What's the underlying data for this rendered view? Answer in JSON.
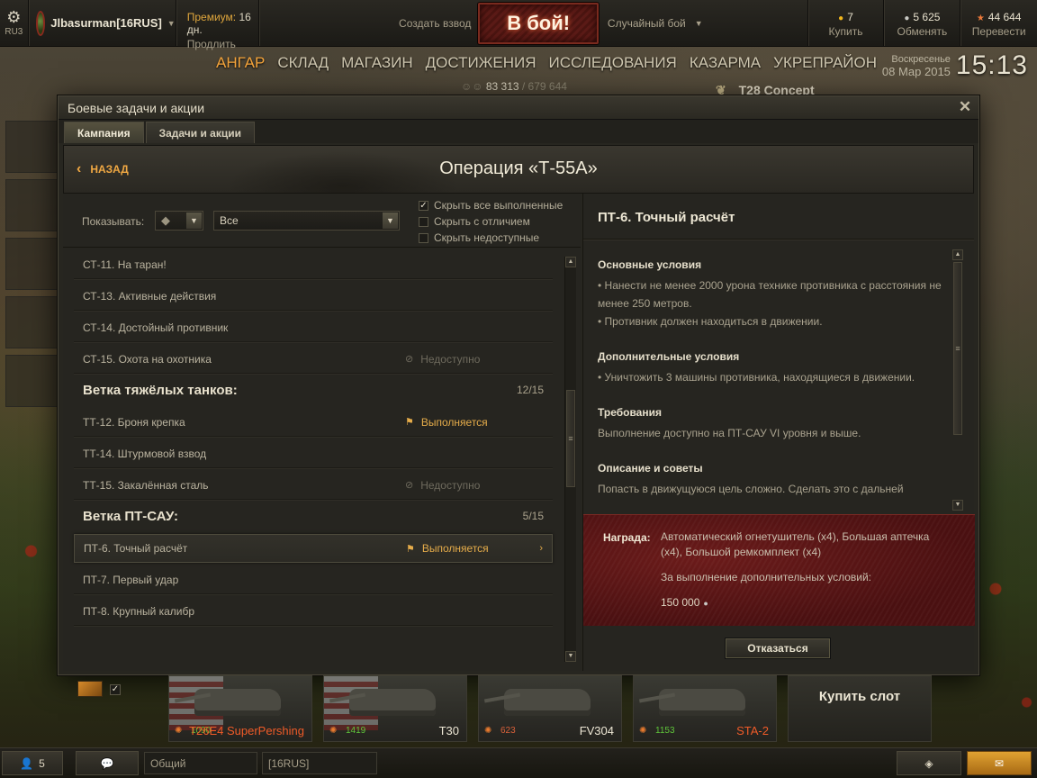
{
  "topbar": {
    "server_icon": "gear-icon",
    "server": "RU3",
    "username": "Jlbasurman[16RUS]",
    "premium_label": "Премиум:",
    "premium_value": "16 дн.",
    "premium_action": "Продлить",
    "platoon": "Создать взвод",
    "battle_button": "В бой!",
    "battle_mode": "Случайный бой",
    "gold_value": "7",
    "gold_action": "Купить",
    "credits_value": "5 625",
    "credits_action": "Обменять",
    "xp_value": "44 644",
    "xp_action": "Перевести"
  },
  "nav": {
    "items": [
      "АНГАР",
      "СКЛАД",
      "МАГАЗИН",
      "ДОСТИЖЕНИЯ",
      "ИССЛЕДОВАНИЯ",
      "КАЗАРМА",
      "УКРЕПРАЙОН"
    ],
    "active_index": 0
  },
  "clock": {
    "weekday": "Воскресенье",
    "date": "08 Мар 2015",
    "time": "15:13"
  },
  "hangar": {
    "online": "83 313",
    "online_total": "/ 679 644",
    "tank_name": "T28 Concept"
  },
  "modal": {
    "title": "Боевые задачи и акции",
    "close": "✕",
    "tabs": [
      "Кампания",
      "Задачи и акции"
    ],
    "active_tab": 0,
    "back_label": "НАЗАД",
    "operation_title": "Операция «Т-55А»"
  },
  "filter": {
    "show_label": "Показывать:",
    "type_value": "◆",
    "category_value": "Все",
    "checkboxes": [
      {
        "label": "Скрыть все выполненные",
        "checked": true
      },
      {
        "label": "Скрыть с отличием",
        "checked": false
      },
      {
        "label": "Скрыть недоступные",
        "checked": false
      }
    ]
  },
  "quests": {
    "rows": [
      {
        "name": "СТ-11. На таран!",
        "status": ""
      },
      {
        "name": "СТ-13. Активные действия",
        "status": ""
      },
      {
        "name": "СТ-14. Достойный противник",
        "status": ""
      },
      {
        "name": "СТ-15. Охота на охотника",
        "status": "Недоступно"
      }
    ],
    "branch_heavy": {
      "title": "Ветка тяжёлых танков:",
      "count": "12/15"
    },
    "heavy_rows": [
      {
        "name": "ТТ-12. Броня крепка",
        "status": "Выполняется"
      },
      {
        "name": "ТТ-14. Штурмовой взвод",
        "status": ""
      },
      {
        "name": "ТТ-15. Закалённая сталь",
        "status": "Недоступно"
      }
    ],
    "branch_td": {
      "title": "Ветка ПТ-САУ:",
      "count": "5/15"
    },
    "td_rows": [
      {
        "name": "ПТ-6. Точный расчёт",
        "status": "Выполняется",
        "selected": true
      },
      {
        "name": "ПТ-7. Первый удар",
        "status": ""
      },
      {
        "name": "ПТ-8. Крупный калибр",
        "status": ""
      }
    ]
  },
  "detail": {
    "title": "ПТ-6. Точный расчёт",
    "main_h": "Основные условия",
    "main_1": "• Нанести не менее 2000 урона технике противника с расстояния не менее 250 метров.",
    "main_2": "• Противник должен находиться в движении.",
    "extra_h": "Дополнительные условия",
    "extra_1": "• Уничтожить 3 машины противника, находящиеся в движении.",
    "req_h": "Требования",
    "req_1": "Выполнение доступно на ПТ-САУ VI уровня и выше.",
    "desc_h": "Описание и советы",
    "desc_1": "Попасть в движущуюся цель сложно. Сделать это с дальней",
    "reward_label": "Награда:",
    "reward_text": "Автоматический огнетушитель (x4), Большая аптечка (x4), Большой ремкомплект (x4)",
    "reward_extra": "За выполнение дополнительных условий:",
    "reward_value": "150 000",
    "decline": "Отказаться"
  },
  "carousel": {
    "tanks": [
      {
        "battles": "1090",
        "name": "T26E4 SuperPershing",
        "premium": true
      },
      {
        "battles": "1419",
        "name": "T30",
        "premium": false
      },
      {
        "battles": "623",
        "name": "FV304",
        "premium": false
      },
      {
        "battles": "1153",
        "name": "STA-2",
        "premium": true
      }
    ],
    "buy_slot": "Купить слот"
  },
  "bottombar": {
    "friends_count": "5",
    "channel_common": "Общий",
    "channel_clan": "[16RUS]"
  },
  "colors": {
    "accent": "#f5a53c",
    "reward_bg": "#5a1415",
    "progress": "#e5ac4a"
  }
}
